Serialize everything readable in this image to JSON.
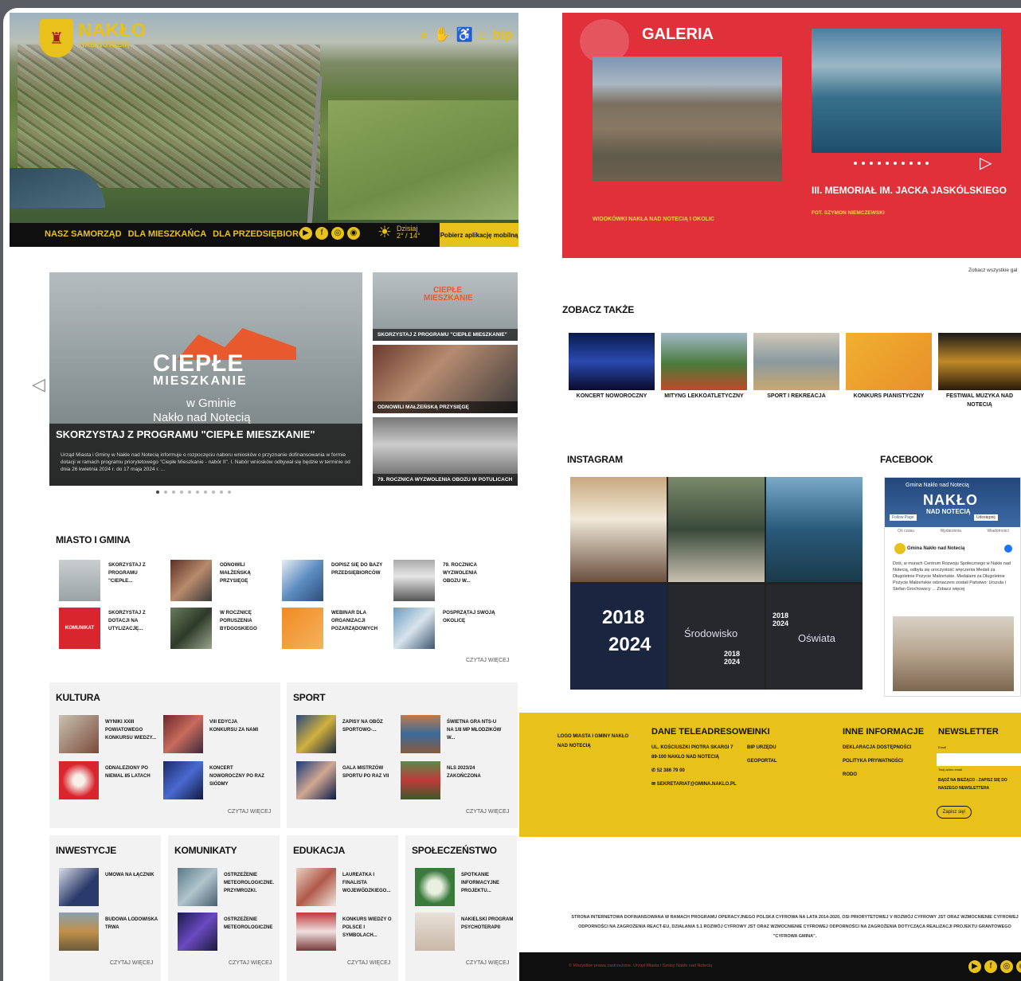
{
  "header": {
    "logo_name": "NAKŁO",
    "logo_sub": "NAD NOTECIĄ",
    "icons": [
      "search-icon",
      "sign-language-icon",
      "accessibility-icon",
      "home-icon"
    ],
    "bip": "bip",
    "nav": [
      "NASZ SAMORZĄD",
      "DLA MIESZKAŃCA",
      "DLA PRZEDSIĘBIORCY"
    ],
    "weather_label": "Dzisiaj",
    "weather_temp": "2° / 14°",
    "app_button": "Pobierz aplikację mobilną"
  },
  "slider": {
    "title_big": "CIEPŁE",
    "title_big2": "MIESZKANIE",
    "sub1": "w Gminie",
    "sub2": "Nakło nad Notecią",
    "caption_title": "SKORZYSTAJ Z PROGRAMU \"CIEPŁE MIESZKANIE\"",
    "caption_text": "Urząd Miasta i Gminy w Nakle nad Notecią informuje o rozpoczęciu naboru wniosków o przyznanie dofinansowania w formie dotacji w ramach programu priorytetowego \"Ciepłe Mieszkanie - nabór II\". I. Nabór wniosków odbywał się będzie w terminie od dnia 26 kwietnia 2024 r. do 17 maja 2024 r. ...",
    "side": [
      "SKORZYSTAJ Z PROGRAMU \"CIEPŁE MIESZKANIE\"",
      "ODNOWILI MAŁŻEŃSKĄ PRZYSIĘGĘ",
      "79. ROCZNICA WYZWOLENIA OBOZU W POTULICACH"
    ],
    "side_thumb_mark": "CIEPŁE MIESZKANIE"
  },
  "miasto": {
    "heading": "MIASTO I GMINA",
    "items": [
      "SKORZYSTAJ Z PROGRAMU \"CIEPŁE...",
      "ODNOWILI MAŁŻEŃSKĄ PRZYSIĘGĘ",
      "DOPISZ SIĘ DO BAZY PRZEDSIĘBIORCÓW",
      "79. ROCZNICA WYZWOLENIA OBOZU W...",
      "SKORZYSTAJ Z DOTACJI NA UTYLIZACJĘ...",
      "W ROCZNICĘ PORUSZENIA BYDGOSKIEGO",
      "WEBINAR DLA ORGANIZACJI POZARZĄDOWYCH",
      "POSPRZĄTAJ SWOJĄ OKOLICĘ"
    ],
    "komunikat_mark": "KOMUNIKAT",
    "more": "CZYTAJ WIĘCEJ"
  },
  "kultura": {
    "heading": "KULTURA",
    "items": [
      "WYNIKI XXIII POWIATOWEGO KONKURSU WIEDZY...",
      "VIII EDYCJA KONKURSU ZA NAMI",
      "ODNALEZIONY PO NIEMAL 85 LATACH",
      "KONCERT NOWOROCZNY PO RAZ SIÓDMY"
    ],
    "more": "CZYTAJ WIĘCEJ"
  },
  "sport": {
    "heading": "SPORT",
    "items": [
      "ZAPISY NA OBÓZ SPORTOWO-...",
      "ŚWIETNA GRA NTS-U NA 1/8 MP MŁODZIKÓW W...",
      "GALA MISTRZÓW SPORTU PO RAZ VII",
      "NLS 2023/24 ZAKOŃCZONA"
    ],
    "more": "CZYTAJ WIĘCEJ"
  },
  "inwestycje": {
    "heading": "INWESTYCJE",
    "items": [
      "UMOWA NA ŁĄCZNIK",
      "BUDOWA LODOWISKA TRWA"
    ],
    "more": "CZYTAJ WIĘCEJ"
  },
  "komunikaty": {
    "heading": "KOMUNIKATY",
    "items": [
      "OSTRZEŻENIE METEOROLOGICZNE. PRZYMROZKI.",
      "OSTRZEŻENIE METEOROLOGICZNE"
    ],
    "more": "CZYTAJ WIĘCEJ"
  },
  "edukacja": {
    "heading": "EDUKACJA",
    "items": [
      "LAUREATKA I FINALISTA WOJEWÓDZKIEGO...",
      "KONKURS WIEDZY O POLSCE I SYMBOLACH..."
    ],
    "more": "CZYTAJ WIĘCEJ"
  },
  "spoleczenstwo": {
    "heading": "SPOŁECZEŃSTWO",
    "items": [
      "SPOTKANIE INFORMACYJNE PROJEKTU...",
      "NAKIELSKI PROGRAM PSYCHOTERAPII"
    ],
    "more": "CZYTAJ WIĘCEJ"
  },
  "galeria": {
    "title": "GALERIA",
    "cap1": "WIDOKÓWKI NAKŁA NAD NOTECIĄ I OKOLIC",
    "cap2": "III. MEMORIAŁ IM. JACKA JASKÓLSKIEGO",
    "foto": "FOT. SZYMON NIEMCZEWSKI",
    "see_all": "Zobacz wszystkie gal"
  },
  "zobacz": {
    "heading": "ZOBACZ TAKŻE",
    "items": [
      "KONCERT NOWOROCZNY",
      "MITYNG LEKKOATLETYCZNY",
      "SPORT I REKREACJA",
      "KONKURS PIANISTYCZNY",
      "FESTIWAL MUZYKA NAD NOTECIĄ"
    ]
  },
  "instagram": {
    "heading": "INSTAGRAM",
    "tiles": [
      "2018",
      "2024",
      "Środowisko",
      "2018 2024",
      "2018 2024",
      "Oświata"
    ]
  },
  "facebook": {
    "heading": "FACEBOOK",
    "page": "Gmina Nakło nad Notecią",
    "page_big": "NAKŁO",
    "page_big2": "NAD NOTECIĄ",
    "follow": "Follow Page",
    "share": "Udostępnij",
    "tabs": [
      "Oś czasu",
      "Wydarzenia",
      "Wiadomości"
    ],
    "post_author": "Gmina Nakło nad Notecią",
    "post_text": "Dziś, w murach Centrum Rozwoju Społecznego w Nakle nad Notecią, odbyła się uroczystość wręczenia Medali za Długoletnie Pożycie Małżeńskie. Medalami za Długoletnie Pożycie Małżeńskie odznaczeni zostali Państwo: Urszula i Stefan Grochowscy ... Zobacz więcej"
  },
  "footer": {
    "logo_text": "LOGO MIASTA I GMINY NAKŁO NAD NOTECIĄ",
    "dane_h": "DANE TELEADRESOWE",
    "dane": [
      "UL. KOŚCIUSZKI PIOTRA SKARGI 7",
      "89-100 NAKŁO NAD NOTECIĄ",
      "52 386 79 00",
      "SEKRETARIAT@GMINA.NAKLO.PL"
    ],
    "linki_h": "LINKI",
    "linki": [
      "BIP URZĘDU",
      "GEOPORTAL"
    ],
    "inne_h": "INNE INFORMACJE",
    "inne": [
      "DEKLARACJA DOSTĘPNOŚCI",
      "POLITYKA PRYWATNOŚCI",
      "RODO"
    ],
    "news_h": "NEWSLETTER",
    "news_label": "Email",
    "news_note": "Twój adres email",
    "news_text": "BĄDŹ NA BIEŻĄCO - ZAPISZ SIĘ DO NASZEGO NEWSLETTERA",
    "news_btn": "Zapisz się!",
    "eu_text": "STRONA INTERNETOWA DOFINANSOWANA W RAMACH PROGRAMU OPERACYJNEGO POLSKA CYFROWA NA LATA 2014-2020, OSI PRIORYTETOWEJ V ROZWÓJ CYFROWY JST ORAZ WZMOCNIENIE CYFROWEJ ODPORNOŚCI NA ZAGROŻENIA REACT-EU, DZIAŁANIA 5.1 ROZWÓJ CYFROWY JST ORAZ WZMOCNIENIE CYFROWEJ ODPORNOŚCI NA ZAGROŻENIA DOTYCZĄCA REALIZACJI PROJEKTU GRANTOWEGO \"CYFROWA GMINA\".",
    "copyright": "© Wszystkie prawa zastrzeżone. Urząd Miasta i Gminy Nakło nad Notecią"
  },
  "colors": {
    "yellow": "#e8c21b",
    "red": "#e0303a",
    "dark": "#0f0f0f"
  }
}
